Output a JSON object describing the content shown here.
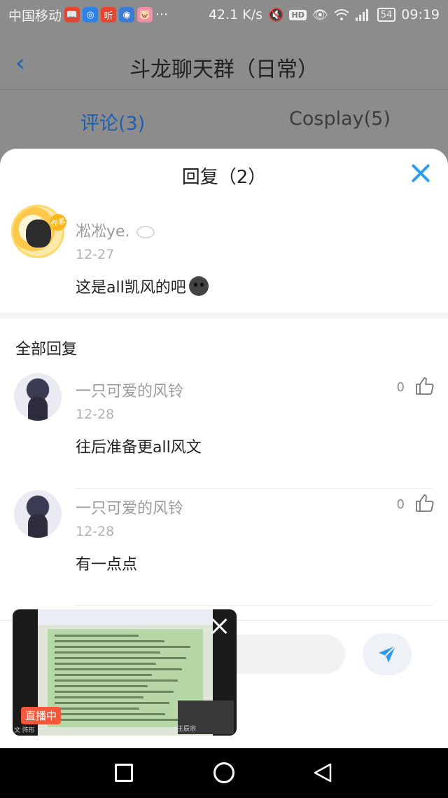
{
  "status_bar": {
    "carrier": "中国移动",
    "network_speed": "42.1 K/s",
    "hd_badge": "HD",
    "battery": "54",
    "time": "09:19",
    "apps": [
      {
        "name": "reader-app-icon",
        "glyph": "📖",
        "color": "#e8432e"
      },
      {
        "name": "sphere-app-icon",
        "glyph": "◎",
        "color": "#2c82e8"
      },
      {
        "name": "ting-app-icon",
        "glyph": "听",
        "color": "#e8432e"
      },
      {
        "name": "browser-app-icon",
        "glyph": "◉",
        "color": "#3a7bd5"
      },
      {
        "name": "pig-app-icon",
        "glyph": "🐷",
        "color": "#f28fa8"
      }
    ],
    "more": "···"
  },
  "header": {
    "back_label": "‹",
    "title": "斗龙聊天群（日常）"
  },
  "tabs": [
    {
      "label": "评论(3)",
      "active": true
    },
    {
      "label": "Cosplay(5)",
      "active": false
    }
  ],
  "sheet": {
    "title": "回复（2）"
  },
  "post": {
    "author_badge": "作者",
    "author": "凇凇ye.",
    "date": "12-27",
    "text": "这是all凯风的吧"
  },
  "replies_section": {
    "title": "全部回复"
  },
  "replies": [
    {
      "author": "一只可爱的风铃",
      "date": "12-28",
      "text": "往后准备更all风文",
      "likes": "0"
    },
    {
      "author": "一只可爱的风铃",
      "date": "12-28",
      "text": "有一点点",
      "likes": "0"
    }
  ],
  "live_window": {
    "badge": "直播中",
    "caption_left": "文 阵形",
    "caption_right": "王辰宗"
  },
  "colors": {
    "accent": "#2b9cf2",
    "tab_active": "#1e5fb0",
    "live_badge": "#f4583b"
  }
}
